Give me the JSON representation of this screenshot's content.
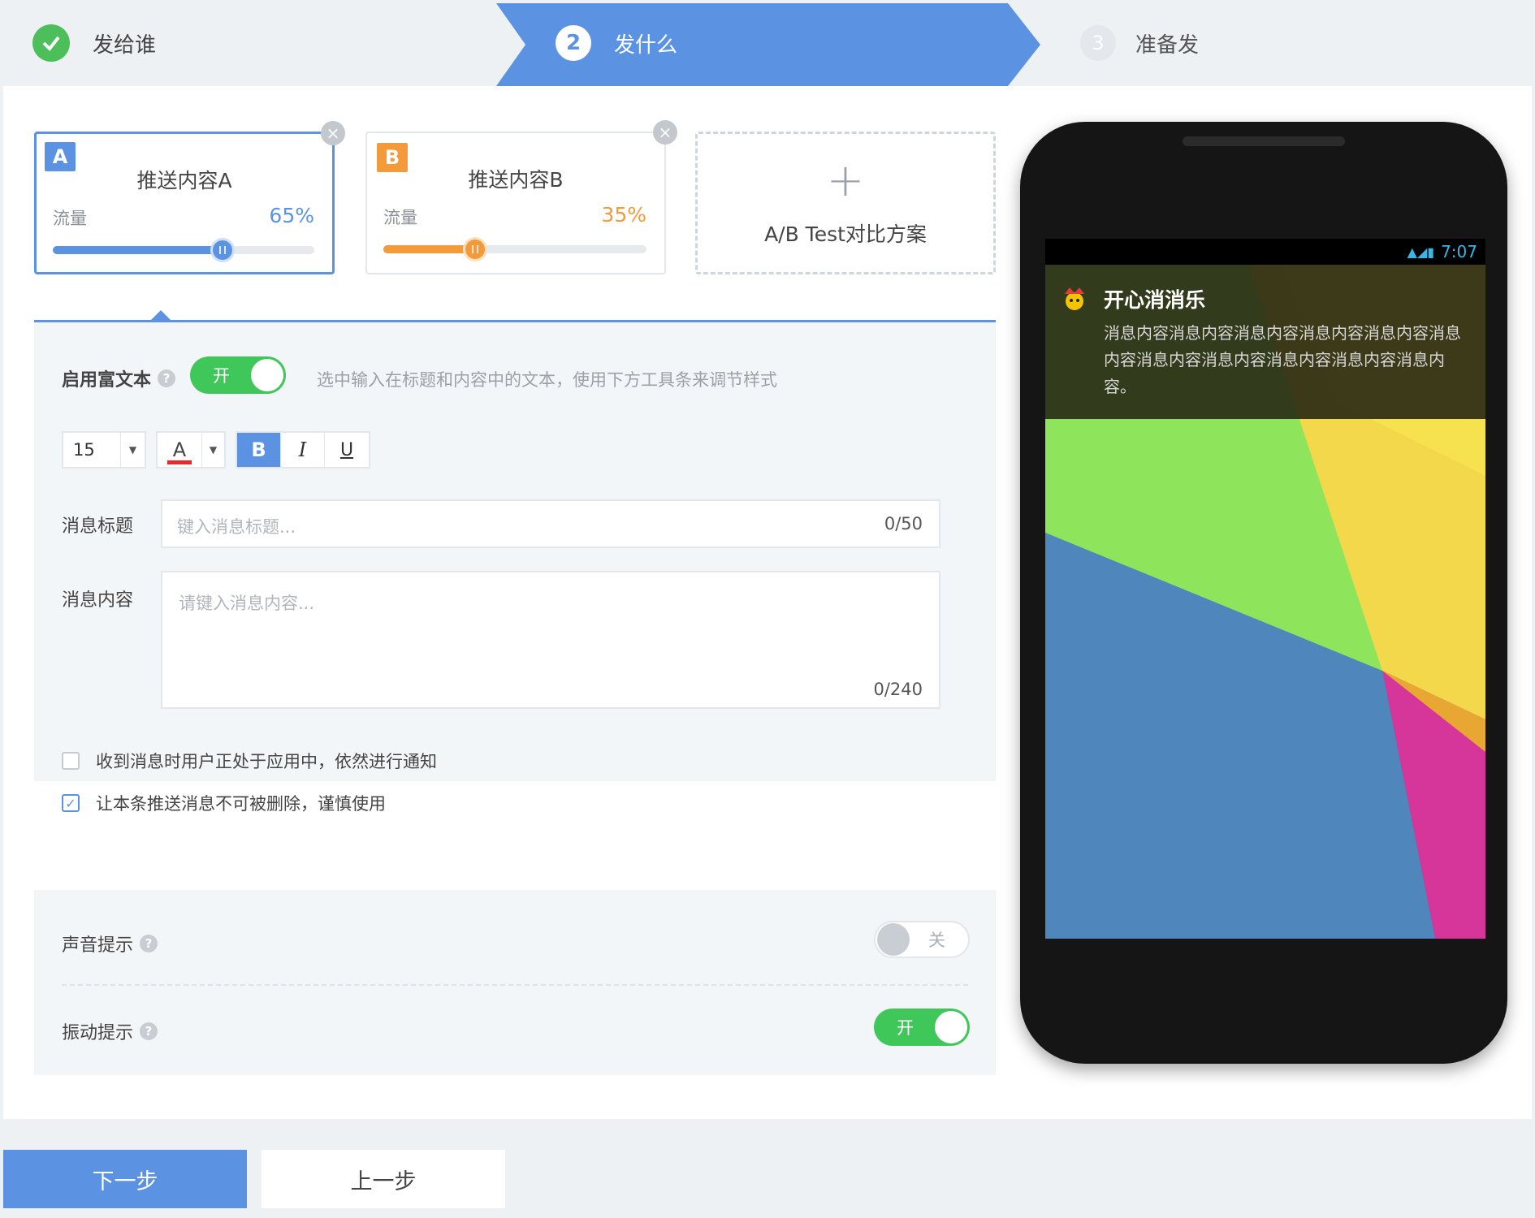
{
  "steps": [
    {
      "label": "发给谁",
      "state": "done"
    },
    {
      "label": "发什么",
      "number": "2",
      "state": "active"
    },
    {
      "label": "准备发",
      "number": "3",
      "state": "pending"
    }
  ],
  "colors": {
    "accent": "#5b93e2",
    "orange": "#f39a3a",
    "green": "#3fc75a"
  },
  "variants": [
    {
      "badge": "A",
      "title": "推送内容A",
      "flow_label": "流量",
      "percent_text": "65%",
      "traffic": 0.65
    },
    {
      "badge": "B",
      "title": "推送内容B",
      "flow_label": "流量",
      "percent_text": "35%",
      "traffic": 0.35
    }
  ],
  "add_variant": {
    "plus": "+",
    "label": "A/B Test对比方案"
  },
  "editor": {
    "rich_text_label": "启用富文本",
    "rich_text_toggle": "开",
    "rich_text_hint": "选中输入在标题和内容中的文本，使用下方工具条来调节样式",
    "font_size": "15",
    "color_letter": "A",
    "bold": "B",
    "italic": "I",
    "underline": "U",
    "title_label": "消息标题",
    "title_placeholder": "键入消息标题...",
    "title_count": "0/50",
    "body_label": "消息内容",
    "body_placeholder": "请键入消息内容...",
    "body_count": "0/240",
    "check_notify": {
      "label": "收到消息时用户正处于应用中，依然进行通知",
      "checked": false
    },
    "check_sticky": {
      "label": "让本条推送消息不可被删除，谨慎使用",
      "checked": true
    }
  },
  "settings": {
    "sound_label": "声音提示",
    "sound_toggle": "关",
    "vibrate_label": "振动提示",
    "vibrate_toggle": "开"
  },
  "phone": {
    "time": "7:07",
    "notif_title": "开心消消乐",
    "notif_text": "消息内容消息内容消息内容消息内容消息内容消息内容消息内容消息内容消息内容消息内容消息内容。"
  },
  "buttons": {
    "next": "下一步",
    "prev": "上一步"
  }
}
